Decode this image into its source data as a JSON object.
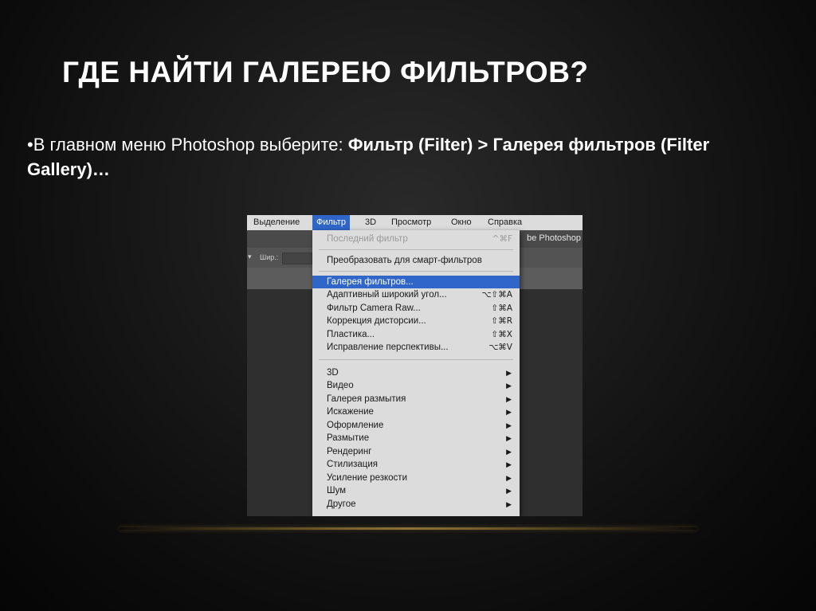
{
  "slide": {
    "title": "ГДЕ НАЙТИ ГАЛЕРЕЮ ФИЛЬТРОВ?",
    "bullet_prefix": "•В главном меню Photoshop выберите: ",
    "bullet_bold": "Фильтр (Filter) > Галерея фильтров (Filter Gallery)…"
  },
  "menubar": {
    "items": [
      "Выделение",
      "Фильтр",
      "3D",
      "Просмотр",
      "Окно",
      "Справка"
    ],
    "active": "Фильтр"
  },
  "window_title_partial": "be Photoshop",
  "options_bar": {
    "width_label": "Шир.:"
  },
  "filter_menu": {
    "items": [
      {
        "label": "Последний фильтр",
        "shortcut": "^⌘F",
        "disabled": true
      },
      {
        "label": "Преобразовать для смарт-фильтров",
        "shortcut": ""
      },
      {
        "label": "Галерея фильтров...",
        "shortcut": "",
        "highlighted": true
      },
      {
        "label": "Адаптивный широкий угол...",
        "shortcut": "⌥⇧⌘A"
      },
      {
        "label": "Фильтр Camera Raw...",
        "shortcut": "⇧⌘A"
      },
      {
        "label": "Коррекция дисторсии...",
        "shortcut": "⇧⌘R"
      },
      {
        "label": "Пластика...",
        "shortcut": "⇧⌘X"
      },
      {
        "label": "Исправление перспективы...",
        "shortcut": "⌥⌘V"
      },
      {
        "label": "3D",
        "submenu": true
      },
      {
        "label": "Видео",
        "submenu": true
      },
      {
        "label": "Галерея размытия",
        "submenu": true
      },
      {
        "label": "Искажение",
        "submenu": true
      },
      {
        "label": "Оформление",
        "submenu": true
      },
      {
        "label": "Размытие",
        "submenu": true
      },
      {
        "label": "Рендеринг",
        "submenu": true
      },
      {
        "label": "Стилизация",
        "submenu": true
      },
      {
        "label": "Усиление резкости",
        "submenu": true
      },
      {
        "label": "Шум",
        "submenu": true
      },
      {
        "label": "Другое",
        "submenu": true
      }
    ],
    "submenu_arrow": "▶"
  },
  "colors": {
    "highlight": "#2f66c8",
    "menu_bg": "#dcdcdc",
    "title_text": "#ffffff"
  }
}
